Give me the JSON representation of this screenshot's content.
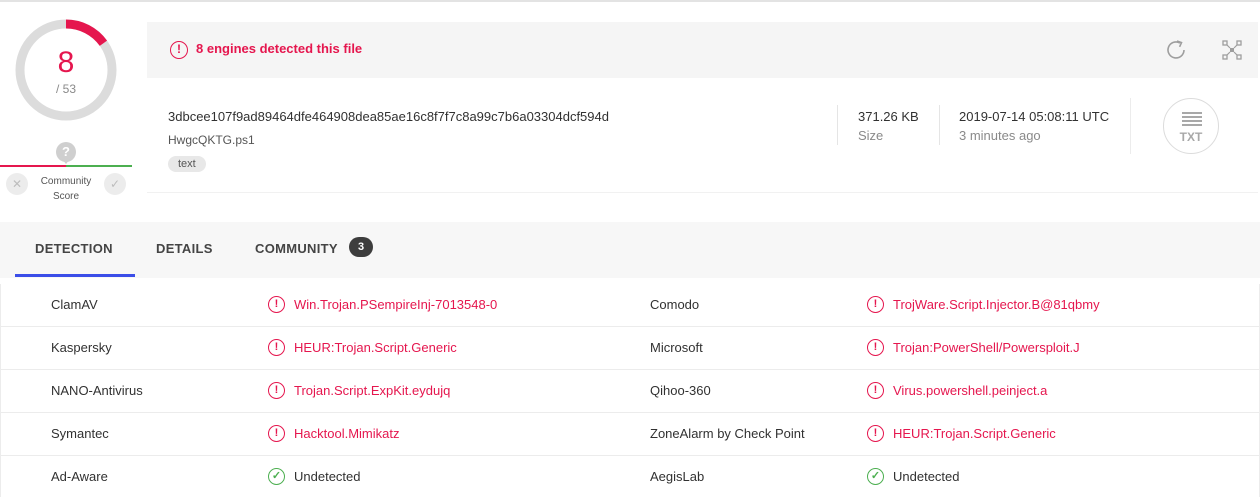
{
  "score": {
    "positives": "8",
    "total": "/ 53",
    "fraction": 0.151
  },
  "community": {
    "label_line1": "Community",
    "label_line2": "Score",
    "question": "?",
    "down_icon": "x-icon",
    "up_icon": "check-icon"
  },
  "banner": {
    "text": "8 engines detected this file",
    "icon": "alert-circle-icon",
    "refresh_icon": "reanalyze-icon",
    "graph_icon": "graph-icon"
  },
  "file": {
    "hash": "3dbcee107f9ad89464dfe464908dea85ae16c8f7f7c8a99c7b6a03304dcf594d",
    "name": "HwgcQKTG.ps1",
    "tag": "text",
    "size_value": "371.26 KB",
    "size_label": "Size",
    "date_value": "2019-07-14 05:08:11 UTC",
    "date_label": "3 minutes ago",
    "type_icon": "TXT"
  },
  "tabs": {
    "detection": "DETECTION",
    "details": "DETAILS",
    "community": "COMMUNITY",
    "community_count": "3"
  },
  "detections": [
    {
      "left_engine": "ClamAV",
      "left_result": "Win.Trojan.PSempireInj-7013548-0",
      "right_engine": "Comodo",
      "right_result": "TrojWare.Script.Injector.B@81qbmy"
    },
    {
      "left_engine": "Kaspersky",
      "left_result": "HEUR:Trojan.Script.Generic",
      "right_engine": "Microsoft",
      "right_result": "Trojan:PowerShell/Powersploit.J"
    },
    {
      "left_engine": "NANO-Antivirus",
      "left_result": "Trojan.Script.ExpKit.eydujq",
      "right_engine": "Qihoo-360",
      "right_result": "Virus.powershell.peinject.a"
    },
    {
      "left_engine": "Symantec",
      "left_result": "Hacktool.Mimikatz",
      "right_engine": "ZoneAlarm by Check Point",
      "right_result": "HEUR:Trojan.Script.Generic"
    },
    {
      "left_engine": "Ad-Aware",
      "left_result": "Undetected",
      "right_engine": "AegisLab",
      "right_result": "Undetected"
    }
  ],
  "colors": {
    "malicious": "#e5164e",
    "clean": "#4caf50",
    "accent": "#3b4ee8"
  }
}
